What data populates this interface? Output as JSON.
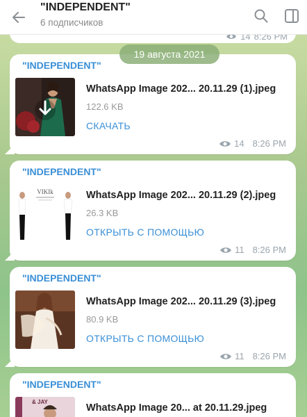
{
  "header": {
    "title": "\"INDEPENDENT\"",
    "subtitle": "6 подписчиков"
  },
  "partial_top": {
    "views": "14",
    "time": "8:26 PM"
  },
  "date_separator": "19 августа 2021",
  "messages": [
    {
      "sender": "\"INDEPENDENT\"",
      "file_name": "WhatsApp Image 202... 20.11.29 (1).jpeg",
      "file_size": "122.6 KB",
      "action": "СКАЧАТЬ",
      "views": "14",
      "time": "8:26 PM",
      "thumb_icon": "download-icon"
    },
    {
      "sender": "\"INDEPENDENT\"",
      "file_name": "WhatsApp Image 202... 20.11.29 (2).jpeg",
      "file_size": "26.3 KB",
      "action": "ОТКРЫТЬ С ПОМОЩЬЮ",
      "views": "11",
      "time": "8:26 PM",
      "thumb_text": "VIKIk"
    },
    {
      "sender": "\"INDEPENDENT\"",
      "file_name": "WhatsApp Image 202... 20.11.29 (3).jpeg",
      "file_size": "80.9 KB",
      "action": "ОТКРЫТЬ С ПОМОЩЬЮ",
      "views": "11",
      "time": "8:26 PM"
    },
    {
      "sender": "\"INDEPENDENT\"",
      "file_name": "WhatsApp Image 20... at 20.11.29.jpeg",
      "thumb_text": "& JAY"
    }
  ],
  "colors": {
    "accent": "#3a8fd6",
    "meta": "#9aa5ad",
    "date_pill": "#8caf78"
  }
}
